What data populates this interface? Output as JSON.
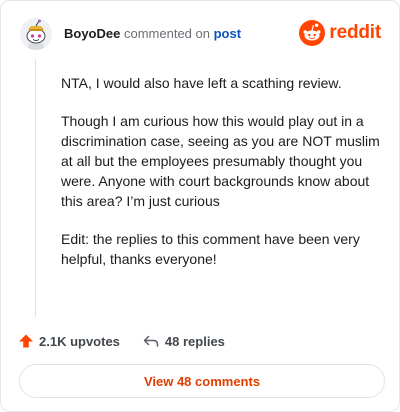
{
  "header": {
    "username": "BoyoDee",
    "action_text": "commented on",
    "post_link": "post",
    "brand_word": "reddit",
    "avatar_icon": "snoo-avatar-icon",
    "brand_icon": "reddit-logo-icon"
  },
  "comment": {
    "paragraphs": [
      "NTA, I would also have left a scathing review.",
      "Though I am curious how this would play out in a discrimination case, seeing as you are NOT muslim at all but the employees presumably thought you were. Anyone with court backgrounds know about this area? I’m just curious",
      "Edit: the replies to this comment have been very helpful, thanks everyone!"
    ]
  },
  "actions": {
    "upvotes": "2.1K upvotes",
    "replies": "48 replies",
    "upvote_icon": "upvote-arrow-icon",
    "reply_icon": "reply-arrow-icon"
  },
  "footer": {
    "view_comments": "View 48 comments"
  },
  "colors": {
    "brand": "#ff4500",
    "link": "#0b55c1",
    "button_text": "#e03e00"
  }
}
